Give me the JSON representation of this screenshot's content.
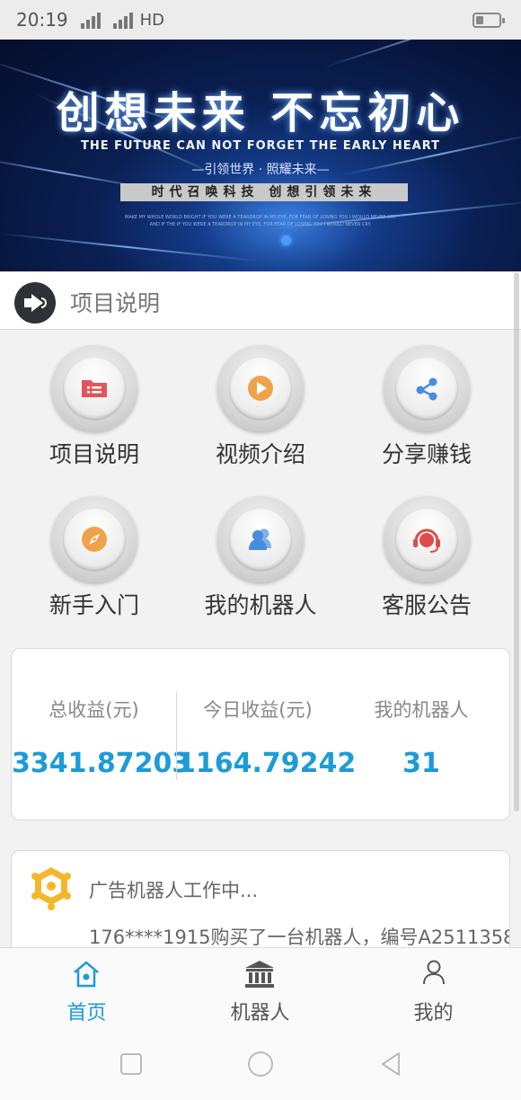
{
  "status_bar": {
    "time": "20:19",
    "net1": "4G",
    "net2": "3G",
    "hd": "HD",
    "battery_level": 0.2
  },
  "banner": {
    "title": "创想未来 不忘初心",
    "subtitle": "THE FUTURE CAN NOT FORGET THE EARLY HEART",
    "tagline": "—引领世界 · 照耀未来—",
    "slogan": "时代召唤科技 创想引领未来",
    "fineprint_1": "MAKE MY WHOLE WORLD BRIGHT IF YOU WERE A TEARDROP IN MY EYE, FOR FEAR OF LOSING YOU I WOULD NEVER CRY",
    "fineprint_2": "AND IF THE IF YOU WERE A TEARDROP IN MY EYE, FOR FEAR OF LOSING YOU I WOULD NEVER CRY."
  },
  "notice": {
    "label": "项目说明"
  },
  "menu": [
    {
      "label": "项目说明",
      "icon": "folder-icon"
    },
    {
      "label": "视频介绍",
      "icon": "play-icon"
    },
    {
      "label": "分享赚钱",
      "icon": "share-icon"
    },
    {
      "label": "新手入门",
      "icon": "compass-icon"
    },
    {
      "label": "我的机器人",
      "icon": "users-icon"
    },
    {
      "label": "客服公告",
      "icon": "headset-icon"
    }
  ],
  "stats": {
    "total_label": "总收益(元)",
    "total_value": "3341.87203",
    "today_label": "今日收益(元)",
    "today_value": "1164.79242",
    "robots_label": "我的机器人",
    "robots_value": "31"
  },
  "ad": {
    "status": "广告机器人工作中...",
    "ticker": "176****1915购买了一台机器人，编号A2511358"
  },
  "tabbar": [
    {
      "label": "首页",
      "icon": "home-icon",
      "active": true
    },
    {
      "label": "机器人",
      "icon": "bank-icon",
      "active": false
    },
    {
      "label": "我的",
      "icon": "user-icon",
      "active": false
    }
  ],
  "colors": {
    "accent": "#1d9bd8",
    "folder": "#e0565b",
    "play": "#f0a24a",
    "share": "#4a8be0",
    "compass": "#f0a24a",
    "users": "#4a8be0",
    "headset": "#e04a4a"
  }
}
